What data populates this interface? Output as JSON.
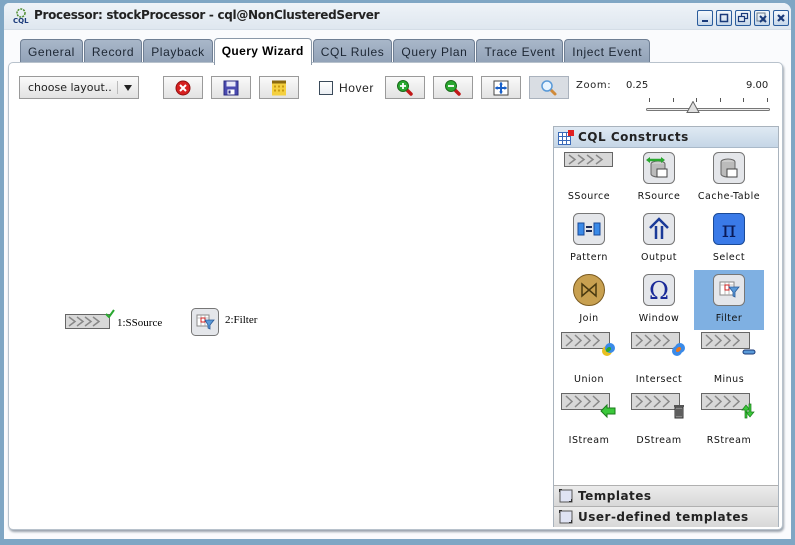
{
  "window": {
    "title": "Processor: stockProcessor - cql@NonClusteredServer",
    "controls": [
      "minimize",
      "maximize",
      "restore",
      "close-other",
      "close"
    ]
  },
  "tabs": [
    {
      "label": "General",
      "active": false
    },
    {
      "label": "Record",
      "active": false
    },
    {
      "label": "Playback",
      "active": false
    },
    {
      "label": "Query Wizard",
      "active": true
    },
    {
      "label": "CQL Rules",
      "active": false
    },
    {
      "label": "Query Plan",
      "active": false
    },
    {
      "label": "Trace Event",
      "active": false
    },
    {
      "label": "Inject Event",
      "active": false
    }
  ],
  "toolbar": {
    "layout_select": "choose layout..",
    "buttons": [
      "delete",
      "save",
      "calendar",
      "zoom-in",
      "zoom-out",
      "fit",
      "magnifier"
    ],
    "hover_label": "Hover",
    "hover_checked": false,
    "zoom_label": "Zoom:",
    "zoom_min": "0.25",
    "zoom_max": "9.00",
    "zoom_value_fraction": 0.37
  },
  "canvas": {
    "nodes": [
      {
        "label": "1:SSource",
        "icon": "stream-icon",
        "validated": true
      },
      {
        "label": "2:Filter",
        "icon": "filter-icon",
        "validated": false
      }
    ]
  },
  "palette": {
    "title": "CQL Constructs",
    "items": [
      {
        "label": "SSource",
        "icon": "stream-icon"
      },
      {
        "label": "RSource",
        "icon": "relation-source-icon"
      },
      {
        "label": "Cache-Table",
        "icon": "cache-table-icon"
      },
      {
        "label": "Pattern",
        "icon": "pattern-icon"
      },
      {
        "label": "Output",
        "icon": "output-icon"
      },
      {
        "label": "Select",
        "icon": "select-pi-icon"
      },
      {
        "label": "Join",
        "icon": "join-icon"
      },
      {
        "label": "Window",
        "icon": "window-omega-icon"
      },
      {
        "label": "Filter",
        "icon": "filter-icon",
        "selected": true
      },
      {
        "label": "Union",
        "icon": "union-icon"
      },
      {
        "label": "Intersect",
        "icon": "intersect-icon"
      },
      {
        "label": "Minus",
        "icon": "minus-icon"
      },
      {
        "label": "IStream",
        "icon": "istream-icon"
      },
      {
        "label": "DStream",
        "icon": "dstream-icon"
      },
      {
        "label": "RStream",
        "icon": "rstream-icon"
      }
    ],
    "sections": [
      "Templates",
      "User-defined templates"
    ]
  }
}
